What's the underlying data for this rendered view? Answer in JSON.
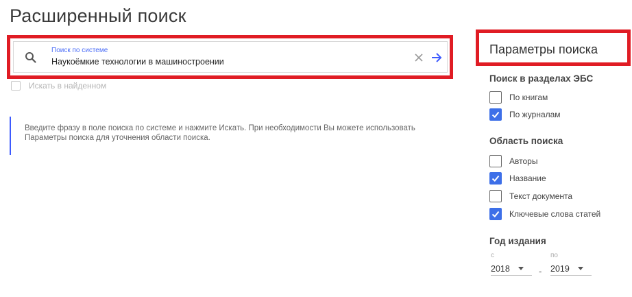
{
  "page": {
    "title": "Расширенный поиск"
  },
  "search": {
    "label": "Поиск по системе",
    "value": "Наукоёмкие технологии в машиностроении",
    "search_in_found_label": "Искать в найденном",
    "search_in_found_checked": false
  },
  "hint": {
    "text": "Введите фразу в поле поиска по системе и нажмите Искать. При необходимости Вы можете использовать Параметры поиска для уточнения области поиска."
  },
  "params": {
    "title": "Параметры поиска",
    "sections_title": "Поиск в разделах ЭБС",
    "sections": [
      {
        "label": "По книгам",
        "checked": false
      },
      {
        "label": "По журналам",
        "checked": true
      }
    ],
    "area_title": "Область поиска",
    "area": [
      {
        "label": "Авторы",
        "checked": false
      },
      {
        "label": "Название",
        "checked": true
      },
      {
        "label": "Текст документа",
        "checked": false
      },
      {
        "label": "Ключевые слова статей",
        "checked": true
      }
    ],
    "year_title": "Год издания",
    "year_from_label": "с",
    "year_from": "2018",
    "year_to_label": "по",
    "year_to": "2019",
    "year_separator": "-"
  },
  "colors": {
    "highlight": "#e01c24",
    "accent": "#3d6fe8"
  }
}
